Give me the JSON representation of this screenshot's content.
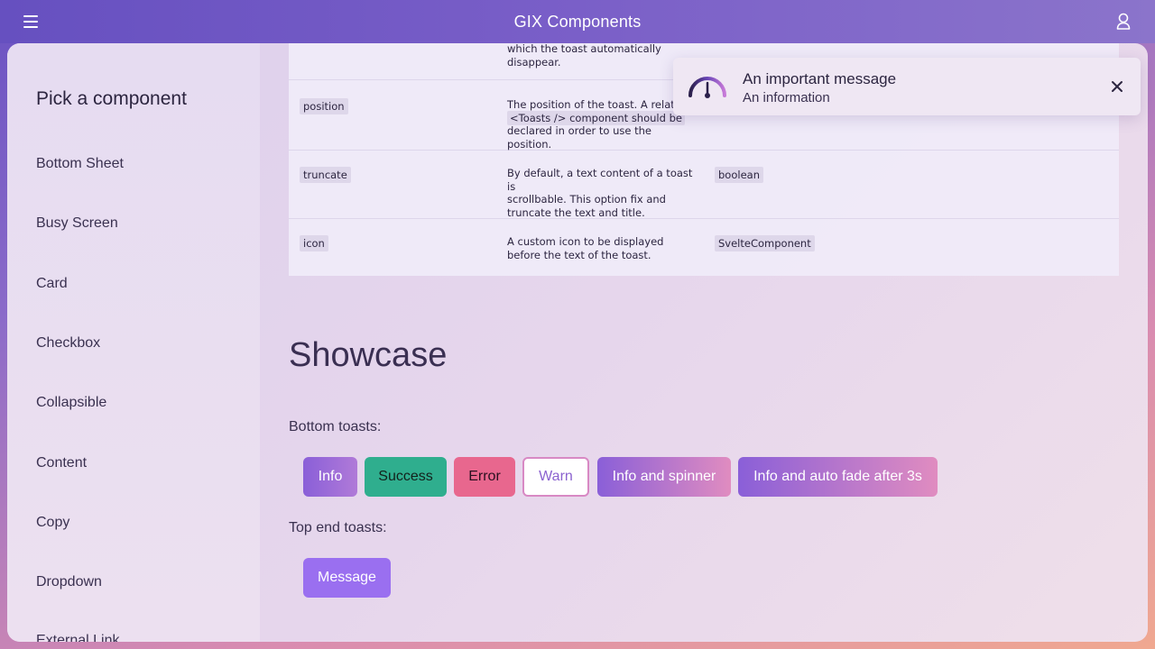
{
  "header": {
    "title": "GIX Components"
  },
  "sidebar": {
    "title": "Pick a component",
    "items": [
      {
        "label": "Bottom Sheet"
      },
      {
        "label": "Busy Screen"
      },
      {
        "label": "Card"
      },
      {
        "label": "Checkbox"
      },
      {
        "label": "Collapsible"
      },
      {
        "label": "Content"
      },
      {
        "label": "Copy"
      },
      {
        "label": "Dropdown"
      },
      {
        "label": "External Link"
      }
    ]
  },
  "api_table": {
    "rows": [
      {
        "name": "",
        "desc_lines": [
          "which the toast automatically",
          "disappear."
        ],
        "type": ""
      },
      {
        "name": "position",
        "desc_lines": [
          "The position of the toast. A related",
          "<Toasts /> component should be",
          "declared in order to use the position."
        ],
        "type": ""
      },
      {
        "name": "truncate",
        "desc_lines": [
          "By default, a text content of a toast is",
          "scrollbable. This option fix and",
          "truncate the text and title."
        ],
        "type": "boolean"
      },
      {
        "name": "icon",
        "desc_lines": [
          "A custom icon to be displayed",
          "before the text of the toast."
        ],
        "type": "SvelteComponent"
      }
    ]
  },
  "showcase": {
    "title": "Showcase",
    "bottom_label": "Bottom toasts:",
    "bottom_buttons": [
      {
        "label": "Info"
      },
      {
        "label": "Success"
      },
      {
        "label": "Error"
      },
      {
        "label": "Warn"
      },
      {
        "label": "Info and spinner"
      },
      {
        "label": "Info and auto fade after 3s"
      }
    ],
    "top_label": "Top end toasts:",
    "top_buttons": [
      {
        "label": "Message"
      }
    ]
  },
  "toast": {
    "title": "An important message",
    "body": "An information",
    "icon": "gauge-icon",
    "close_icon": "close-icon"
  },
  "colors": {
    "info": "#8b5cd6",
    "success": "#2fae8e",
    "error": "#e8678e",
    "warn_border": "#d889c4",
    "warn_text": "#8b62cf",
    "message": "#9a6ff0"
  }
}
